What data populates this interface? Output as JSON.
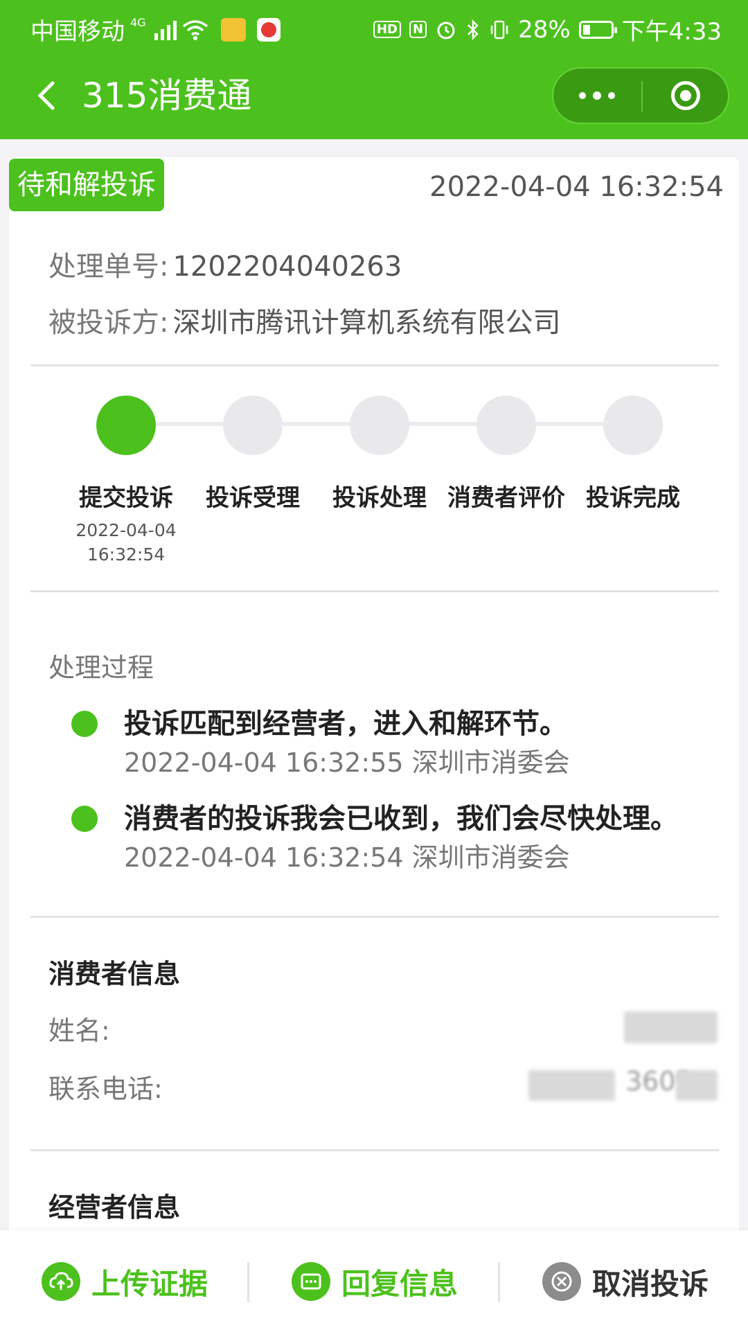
{
  "status_bar": {
    "carrier": "中国移动",
    "network_tag": "4G",
    "hd_label": "HD",
    "nfc_label": "N",
    "battery_percent": "28%",
    "time": "下午4:33"
  },
  "nav": {
    "title": "315消费通",
    "back_icon": "chevron-left-icon",
    "more_icon": "more-dots-icon",
    "close_icon": "target-circle-icon"
  },
  "complaint": {
    "status_badge": "待和解投诉",
    "created_time": "2022-04-04 16:32:54",
    "order_no_label": "处理单号:",
    "order_no": "1202204040263",
    "respondent_label": "被投诉方:",
    "respondent": "深圳市腾讯计算机系统有限公司"
  },
  "progress": {
    "current_step": 1,
    "steps": [
      {
        "label": "提交投诉",
        "date": "2022-04-04",
        "time": "16:32:54"
      },
      {
        "label": "投诉受理",
        "date": "",
        "time": ""
      },
      {
        "label": "投诉处理",
        "date": "",
        "time": ""
      },
      {
        "label": "消费者评价",
        "date": "",
        "time": ""
      },
      {
        "label": "投诉完成",
        "date": "",
        "time": ""
      }
    ]
  },
  "process": {
    "label": "处理过程",
    "items": [
      {
        "text": "投诉匹配到经营者，进入和解环节。",
        "meta": "2022-04-04 16:32:55 深圳市消委会"
      },
      {
        "text": "消费者的投诉我会已收到，我们会尽快处理。",
        "meta": "2022-04-04 16:32:54 深圳市消委会"
      }
    ]
  },
  "consumer_info": {
    "title": "消费者信息",
    "name_label": "姓名:",
    "phone_label": "联系电话:",
    "phone_visible_fragment": "3609"
  },
  "merchant_info": {
    "title": "经营者信息"
  },
  "actions": {
    "upload": "上传证据",
    "reply": "回复信息",
    "cancel": "取消投诉"
  },
  "colors": {
    "brand_green": "#4cc11d",
    "capsule_green": "#3a9b12"
  }
}
